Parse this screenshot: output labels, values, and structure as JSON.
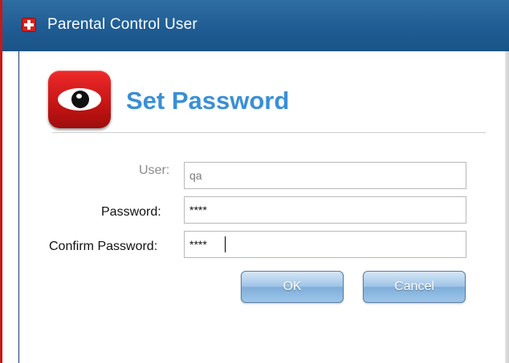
{
  "window": {
    "title": "Parental Control User",
    "accent_color": "#1f5c93",
    "title_icon": "red-cross-icon"
  },
  "header": {
    "logo_icon": "eye-icon",
    "title": "Set Password",
    "title_color": "#3a8fd6"
  },
  "form": {
    "user_label": "User:",
    "user_value": "qa",
    "password_label": "Password:",
    "password_value": "****",
    "confirm_label": "Confirm Password:",
    "confirm_value": "****"
  },
  "buttons": {
    "ok_label": "OK",
    "cancel_label": "Cancel"
  }
}
